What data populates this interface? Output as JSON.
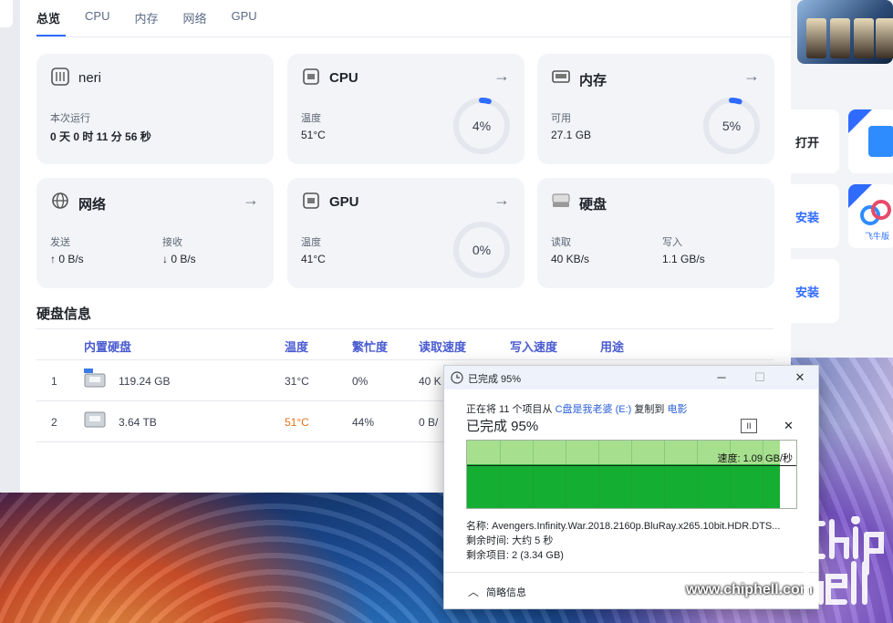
{
  "tabs": [
    {
      "label": "总览",
      "active": true
    },
    {
      "label": "CPU"
    },
    {
      "label": "内存"
    },
    {
      "label": "网络"
    },
    {
      "label": "GPU"
    }
  ],
  "cards": {
    "system": {
      "title": "neri",
      "uptime_label": "本次运行",
      "uptime_value": "0 天 0 时 11 分 56 秒"
    },
    "cpu": {
      "title": "CPU",
      "temp_label": "温度",
      "temp_value": "51°C",
      "usage": "4%",
      "usage_fraction": 0.04
    },
    "memory": {
      "title": "内存",
      "avail_label": "可用",
      "avail_value": "27.1 GB",
      "usage": "5%",
      "usage_fraction": 0.05
    },
    "network": {
      "title": "网络",
      "send_label": "发送",
      "send_value": "↑ 0 B/s",
      "recv_label": "接收",
      "recv_value": "↓ 0 B/s"
    },
    "gpu": {
      "title": "GPU",
      "temp_label": "温度",
      "temp_value": "41°C",
      "usage": "0%",
      "usage_fraction": 0.0
    },
    "disk": {
      "title": "硬盘",
      "read_label": "读取",
      "read_value": "40 KB/s",
      "write_label": "写入",
      "write_value": "1.1 GB/s"
    }
  },
  "disk_info": {
    "title": "硬盘信息",
    "columns": [
      "内置硬盘",
      "温度",
      "繁忙度",
      "读取速度",
      "写入速度",
      "用途"
    ],
    "rows": [
      {
        "index": "1",
        "size": "119.24 GB",
        "temp": "31°C",
        "busy": "0%",
        "read": "40 K",
        "temp_warn": false
      },
      {
        "index": "2",
        "size": "3.64 TB",
        "temp": "51°C",
        "busy": "44%",
        "read": "0 B/",
        "temp_warn": true
      }
    ]
  },
  "right_panel": {
    "open_label": "打开",
    "install_label_1": "安装",
    "install_label_2": "安装",
    "app_badge": "飞牛版"
  },
  "copy_dialog": {
    "title": "已完成 95%",
    "line_prefix": "正在将 11 个项目从",
    "source": "C盘是我老婆 (E:)",
    "copy_to": "复制到",
    "dest": "电影",
    "progress": "已完成 95%",
    "progress_fraction": 0.95,
    "speed": "速度: 1.09 GB/秒",
    "name_line": "名称: Avengers.Infinity.War.2018.2160p.BluRay.x265.10bit.HDR.DTS...",
    "time_line": "剩余时间: 大约 5 秒",
    "items_line": "剩余项目: 2 (3.34 GB)",
    "details_label": "简略信息"
  },
  "watermark": "www.chiphell.com",
  "colors": {
    "accent": "#2f6bff",
    "warn": "#e8711c",
    "graph_fill": "#14ae33",
    "graph_done": "#a6e08e"
  }
}
